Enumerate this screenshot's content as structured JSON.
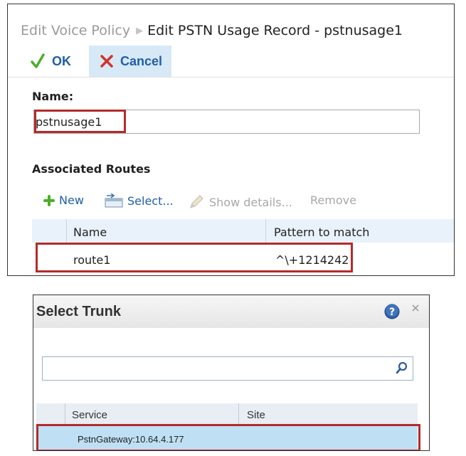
{
  "breadcrumb": {
    "parent": "Edit Voice Policy",
    "current": "Edit PSTN Usage Record - pstnusage1"
  },
  "toolbar": {
    "ok_label": "OK",
    "cancel_label": "Cancel"
  },
  "form": {
    "name_label": "Name:",
    "name_value": "pstnusage1"
  },
  "routes": {
    "section_label": "Associated Routes",
    "new_label": "New",
    "select_label": "Select...",
    "show_details_label": "Show details...",
    "remove_label": "Remove",
    "columns": [
      "Name",
      "Pattern to match"
    ],
    "rows": [
      {
        "name": "route1",
        "pattern": "^\\+1214242"
      }
    ]
  },
  "trunk_dialog": {
    "title": "Select Trunk",
    "search_value": "",
    "columns": [
      "Service",
      "Site"
    ],
    "rows": [
      {
        "service": "PstnGateway:10.64.4.177",
        "site": ""
      }
    ]
  },
  "colors": {
    "accent": "#1f5fa8",
    "highlight": "#b42b2b",
    "selected_row": "#bfe0f4"
  },
  "icons": [
    "check-icon",
    "cancel-x-icon",
    "plus-icon",
    "select-icon",
    "pencil-icon",
    "help-icon",
    "close-icon",
    "search-icon"
  ]
}
